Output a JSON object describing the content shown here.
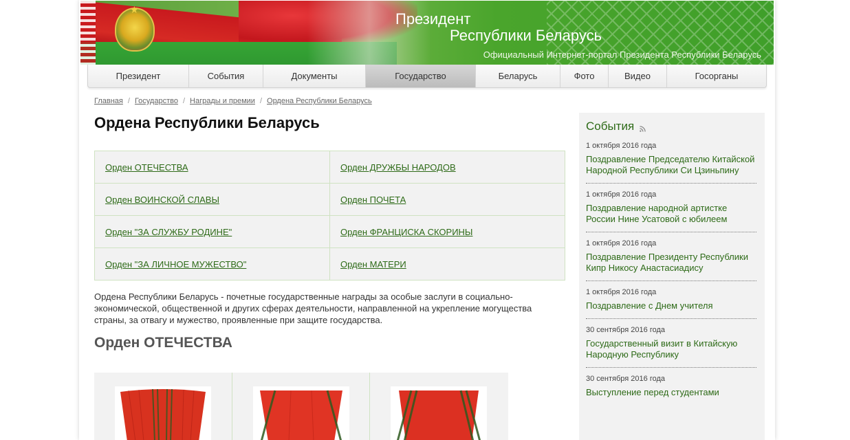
{
  "header": {
    "title_line1": "Президент",
    "title_line2": "Республики Беларусь",
    "subtitle": "Официальный Интернет-портал Президента Республики Беларусь"
  },
  "nav": [
    {
      "label": "Президент",
      "active": false
    },
    {
      "label": "События",
      "active": false
    },
    {
      "label": "Документы",
      "active": false
    },
    {
      "label": "Государство",
      "active": true
    },
    {
      "label": "Беларусь",
      "active": false
    },
    {
      "label": "Фото",
      "active": false
    },
    {
      "label": "Видео",
      "active": false
    },
    {
      "label": "Госорганы",
      "active": false
    }
  ],
  "breadcrumb": [
    "Главная",
    "Государство",
    "Награды и премии",
    "Ордена Республики Беларусь"
  ],
  "page_title": "Ордена Республики Беларусь",
  "orders": [
    [
      "Орден ОТЕЧЕСТВА",
      "Орден ДРУЖБЫ НАРОДОВ"
    ],
    [
      "Орден ВОИНСКОЙ СЛАВЫ",
      "Орден ПОЧЕТА"
    ],
    [
      "Орден \"ЗА СЛУЖБУ РОДИНЕ\"",
      "Орден ФРАНЦИСКА СКОРИНЫ"
    ],
    [
      "Орден \"ЗА ЛИЧНОЕ МУЖЕСТВО\"",
      "Орден МАТЕРИ"
    ]
  ],
  "intro_text": "Ордена Республики Беларусь - почетные государственные награды за особые заслуги в социально-экономической, общественной и других сферах деятельности, направленной на укрепление могущества страны, за отвагу и мужество, проявленные при защите государства.",
  "section_title": "Орден ОТЕЧЕСТВА",
  "sidebar": {
    "title": "События",
    "events": [
      {
        "date": "1 октября 2016 года",
        "title": "Поздравление Председателю Китайской Народной Республики Си Цзиньпину"
      },
      {
        "date": "1 октября 2016 года",
        "title": "Поздравление народной артистке России Нине Усатовой с юбилеем"
      },
      {
        "date": "1 октября 2016 года",
        "title": "Поздравление Президенту Республики Кипр Никосу Анастасиадису"
      },
      {
        "date": "1 октября 2016 года",
        "title": "Поздравление с Днем учителя"
      },
      {
        "date": "30 сентября 2016 года",
        "title": "Государственный визит в Китайскую Народную Республику"
      },
      {
        "date": "30 сентября 2016 года",
        "title": "Выступление перед студентами"
      }
    ]
  },
  "colors": {
    "brand_green": "#4aa52c",
    "link_green": "#2d6a17",
    "flag_red": "#c8191e"
  }
}
